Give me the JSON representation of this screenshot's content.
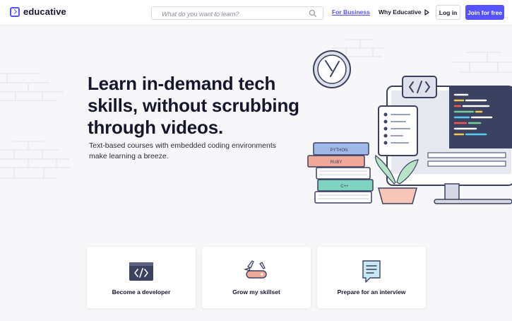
{
  "nav": {
    "logo_text": "educative",
    "search_placeholder": "What do you want to learn?",
    "for_business": "For Business",
    "why_educative": "Why Educative",
    "login": "Log in",
    "join": "Join for free"
  },
  "hero": {
    "title": "Learn in-demand tech skills, without scrubbing through videos.",
    "subtitle": "Text-based courses with embedded coding environments make learning a breeze."
  },
  "illustration": {
    "books": [
      "PYTHON",
      "RUBY",
      "C++"
    ]
  },
  "cards": [
    {
      "label": "Become a developer",
      "icon": "code-window-icon"
    },
    {
      "label": "Grow my skillset",
      "icon": "swiss-knife-icon"
    },
    {
      "label": "Prepare for an interview",
      "icon": "chat-document-icon"
    }
  ],
  "colors": {
    "accent": "#5553ff",
    "background": "#f7f7f9",
    "heading": "#16172c"
  }
}
